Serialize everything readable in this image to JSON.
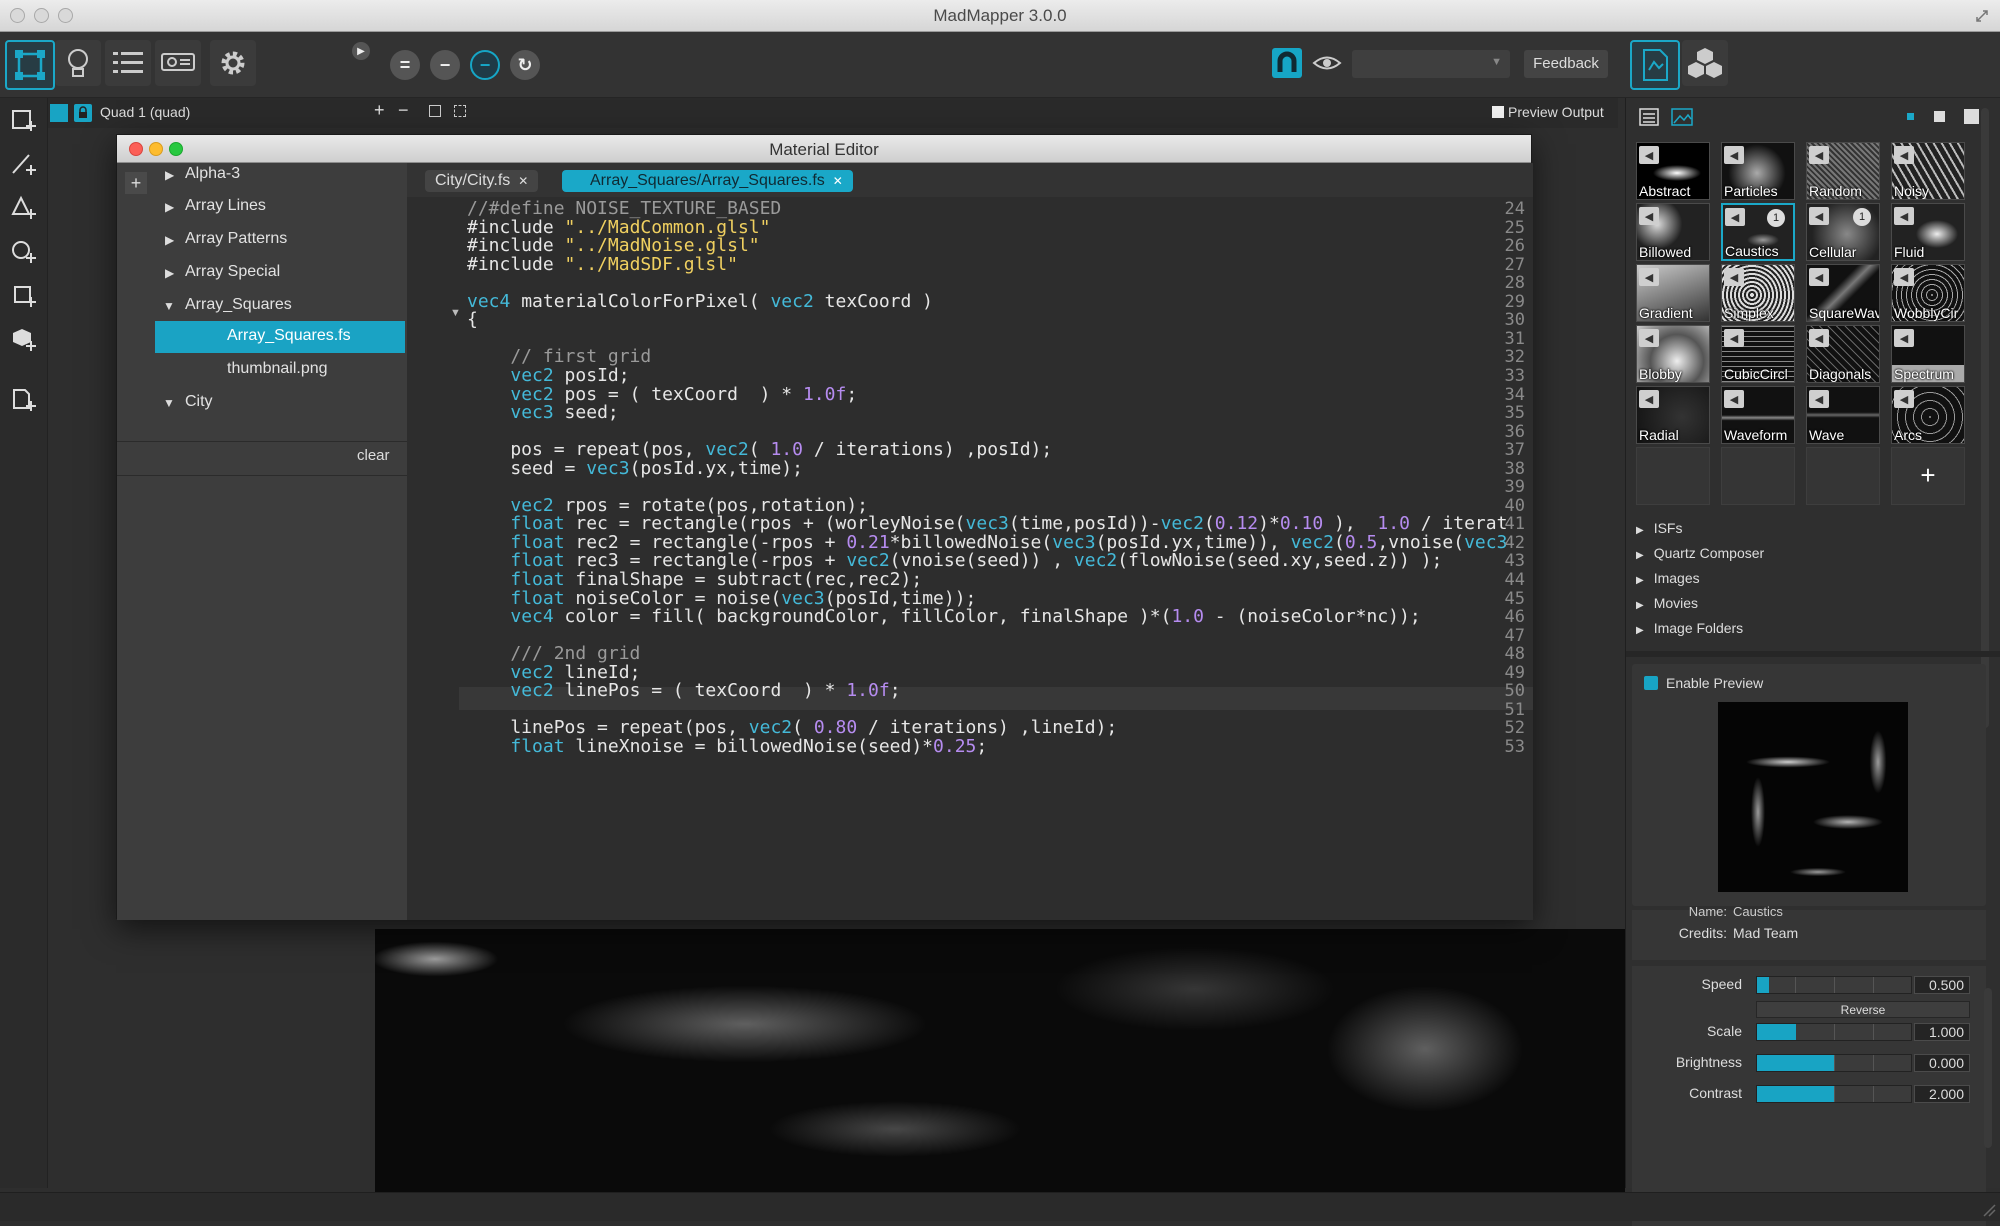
{
  "app": {
    "title": "MadMapper 3.0.0"
  },
  "toolbar": {
    "feedback_label": "Feedback",
    "dropdown_value": "",
    "accent": "#1ba8c8"
  },
  "quad": {
    "name": "Quad 1 (quad)",
    "preview_output_label": "Preview Output"
  },
  "editor": {
    "title": "Material Editor",
    "clear_label": "clear",
    "tree": [
      {
        "label": "Alpha-3",
        "expanded": false
      },
      {
        "label": "Array Lines",
        "expanded": false
      },
      {
        "label": "Array Patterns",
        "expanded": false
      },
      {
        "label": "Array Special",
        "expanded": false
      },
      {
        "label": "Array_Squares",
        "expanded": true
      },
      {
        "label": "Array_Squares.fs",
        "selected": true
      },
      {
        "label": "thumbnail.png"
      },
      {
        "label": "City",
        "expanded": true
      }
    ],
    "tabs": [
      {
        "label": "City/City.fs",
        "active": false
      },
      {
        "label": "Array_Squares/Array_Squares.fs",
        "active": true
      }
    ],
    "code_lines": [
      {
        "n": "24",
        "text": "//#define NOISE_TEXTURE_BASED"
      },
      {
        "n": "25",
        "text": "#include \"../MadCommon.glsl\""
      },
      {
        "n": "26",
        "text": "#include \"../MadNoise.glsl\""
      },
      {
        "n": "27",
        "text": "#include \"../MadSDF.glsl\""
      },
      {
        "n": "28",
        "text": ""
      },
      {
        "n": "29",
        "text": "vec4 materialColorForPixel( vec2 texCoord )"
      },
      {
        "n": "30",
        "text": "{"
      },
      {
        "n": "31",
        "text": ""
      },
      {
        "n": "32",
        "text": "    // first grid"
      },
      {
        "n": "33",
        "text": "    vec2 posId;"
      },
      {
        "n": "34",
        "text": "    vec2 pos = ( texCoord  ) * 1.0f;"
      },
      {
        "n": "35",
        "text": "    vec3 seed;"
      },
      {
        "n": "36",
        "text": ""
      },
      {
        "n": "37",
        "text": "    pos = repeat(pos, vec2( 1.0 / iterations) ,posId);"
      },
      {
        "n": "38",
        "text": "    seed = vec3(posId.yx,time);"
      },
      {
        "n": "39",
        "text": ""
      },
      {
        "n": "40",
        "text": "    vec2 rpos = rotate(pos,rotation);"
      },
      {
        "n": "41",
        "text": "    float rec = rectangle(rpos + (worleyNoise(vec3(time,posId))-vec2(0.12)*0.10 ),  1.0 / iterat"
      },
      {
        "n": "42",
        "text": "    float rec2 = rectangle(-rpos + 0.21*billowedNoise(vec3(posId.yx,time)), vec2(0.5,vnoise(vec3"
      },
      {
        "n": "43",
        "text": "    float rec3 = rectangle(-rpos + vec2(vnoise(seed)) , vec2(flowNoise(seed.xy,seed.z)) );"
      },
      {
        "n": "44",
        "text": "    float finalShape = subtract(rec,rec2);"
      },
      {
        "n": "45",
        "text": "    float noiseColor = noise(vec3(posId,time));"
      },
      {
        "n": "46",
        "text": "    vec4 color = fill( backgroundColor, fillColor, finalShape )*(1.0 - (noiseColor*nc));"
      },
      {
        "n": "47",
        "text": ""
      },
      {
        "n": "48",
        "text": "    /// 2nd grid"
      },
      {
        "n": "49",
        "text": "    vec2 lineId;"
      },
      {
        "n": "50",
        "text": "    vec2 linePos = ( texCoord  ) * 1.0f;"
      },
      {
        "n": "51",
        "text": ""
      },
      {
        "n": "52",
        "text": "    linePos = repeat(pos, vec2( 0.80 / iterations) ,lineId);"
      },
      {
        "n": "53",
        "text": "    float lineXnoise = billowedNoise(seed)*0.25;"
      }
    ]
  },
  "materials": [
    {
      "label": "Abstract"
    },
    {
      "label": "Particles"
    },
    {
      "label": "Random"
    },
    {
      "label": "Noisy"
    },
    {
      "label": "Billowed"
    },
    {
      "label": "Caustics",
      "badge": "1",
      "selected": true
    },
    {
      "label": "Cellular",
      "badge": "1"
    },
    {
      "label": "Fluid"
    },
    {
      "label": "Gradient"
    },
    {
      "label": "Simplex"
    },
    {
      "label": "SquareWav"
    },
    {
      "label": "WobblyCir"
    },
    {
      "label": "Blobby"
    },
    {
      "label": "CubicCircl"
    },
    {
      "label": "Diagonals"
    },
    {
      "label": "Spectrum"
    },
    {
      "label": "Radial"
    },
    {
      "label": "Waveform"
    },
    {
      "label": "Wave"
    },
    {
      "label": "Arcs"
    }
  ],
  "add_material_label": "+",
  "categories": [
    {
      "label": "ISFs"
    },
    {
      "label": "Quartz Composer"
    },
    {
      "label": "Images"
    },
    {
      "label": "Movies"
    },
    {
      "label": "Image Folders"
    }
  ],
  "preview_panel": {
    "enable_preview_label": "Enable Preview",
    "name_label": "Name:",
    "name_value": "Caustics",
    "credits_label": "Credits:",
    "credits_value": "Mad Team"
  },
  "params": {
    "speed": {
      "label": "Speed",
      "value": "0.500",
      "level": 0.08
    },
    "reverse_label": "Reverse",
    "scale": {
      "label": "Scale",
      "value": "1.000",
      "level": 0.25
    },
    "brightness": {
      "label": "Brightness",
      "value": "0.000",
      "level": 0.5
    },
    "contrast": {
      "label": "Contrast",
      "value": "2.000",
      "level": 0.5
    }
  }
}
